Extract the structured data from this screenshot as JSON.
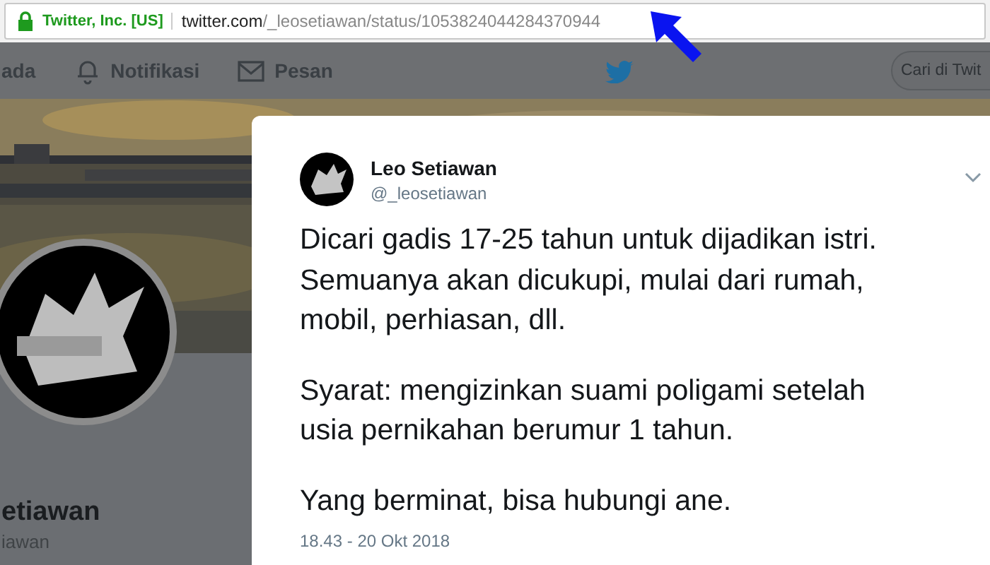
{
  "address_bar": {
    "site_identity": "Twitter, Inc. [US]",
    "url_host": "twitter.com",
    "url_path": "/_leosetiawan/status/1053824044284370944"
  },
  "nav": {
    "items": [
      {
        "label": "ada",
        "kind": "home"
      },
      {
        "label": "Notifikasi",
        "kind": "bell"
      },
      {
        "label": "Pesan",
        "kind": "mail"
      }
    ],
    "search": {
      "placeholder": "Cari di Twit"
    }
  },
  "profile": {
    "name": "etiawan",
    "handle": "iawan"
  },
  "tweet": {
    "name": "Leo Setiawan",
    "handle": "@_leosetiawan",
    "paragraphs": [
      "Dicari gadis 17-25 tahun untuk dijadikan istri.\nSemuanya akan dicukupi, mulai dari rumah,\nmobil, perhiasan, dll.",
      "Syarat: mengizinkan suami poligami setelah\nusia pernikahan berumur 1 tahun.",
      "Yang berminat, bisa hubungi ane."
    ],
    "timestamp": "18.43 - 20 Okt 2018"
  }
}
